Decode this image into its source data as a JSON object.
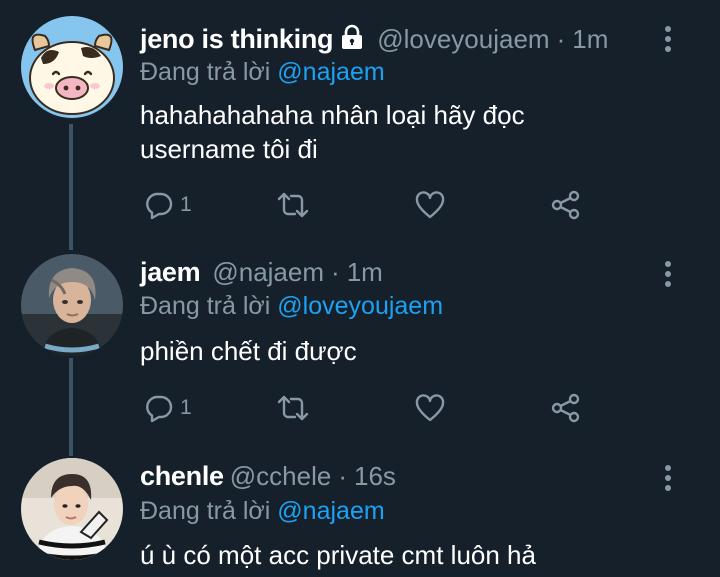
{
  "colors": {
    "background": "#15202b",
    "secondary_text": "#8899a6",
    "mention": "#1da1f2",
    "thread_line": "#3d5466"
  },
  "tweets": [
    {
      "display_name": "jeno is thinking",
      "protected": true,
      "handle": "@loveyoujaem",
      "separator": "·",
      "time": "1m",
      "reply_prefix": "Đang trả lời",
      "reply_to": "@najaem",
      "text_lines": [
        "hahahahahaha nhân loại hãy đọc",
        "username tôi đi"
      ],
      "reply_count": "1",
      "avatar_icon": "cartoon-pig-cow-avatar"
    },
    {
      "display_name": "jaem",
      "protected": false,
      "handle": "@najaem",
      "separator": "·",
      "time": "1m",
      "reply_prefix": "Đang trả lời",
      "reply_to": "@loveyoujaem",
      "text_lines": [
        "phiền chết đi được"
      ],
      "reply_count": "1",
      "avatar_icon": "person-photo-avatar"
    },
    {
      "display_name": "chenle",
      "protected": false,
      "handle": "@cchele",
      "separator": "·",
      "time": "16s",
      "reply_prefix": "Đang trả lời",
      "reply_to": "@najaem",
      "text_lines": [
        "ú ù có một acc private cmt luôn hả"
      ],
      "reply_count": "",
      "avatar_icon": "person-photo-avatar"
    }
  ]
}
